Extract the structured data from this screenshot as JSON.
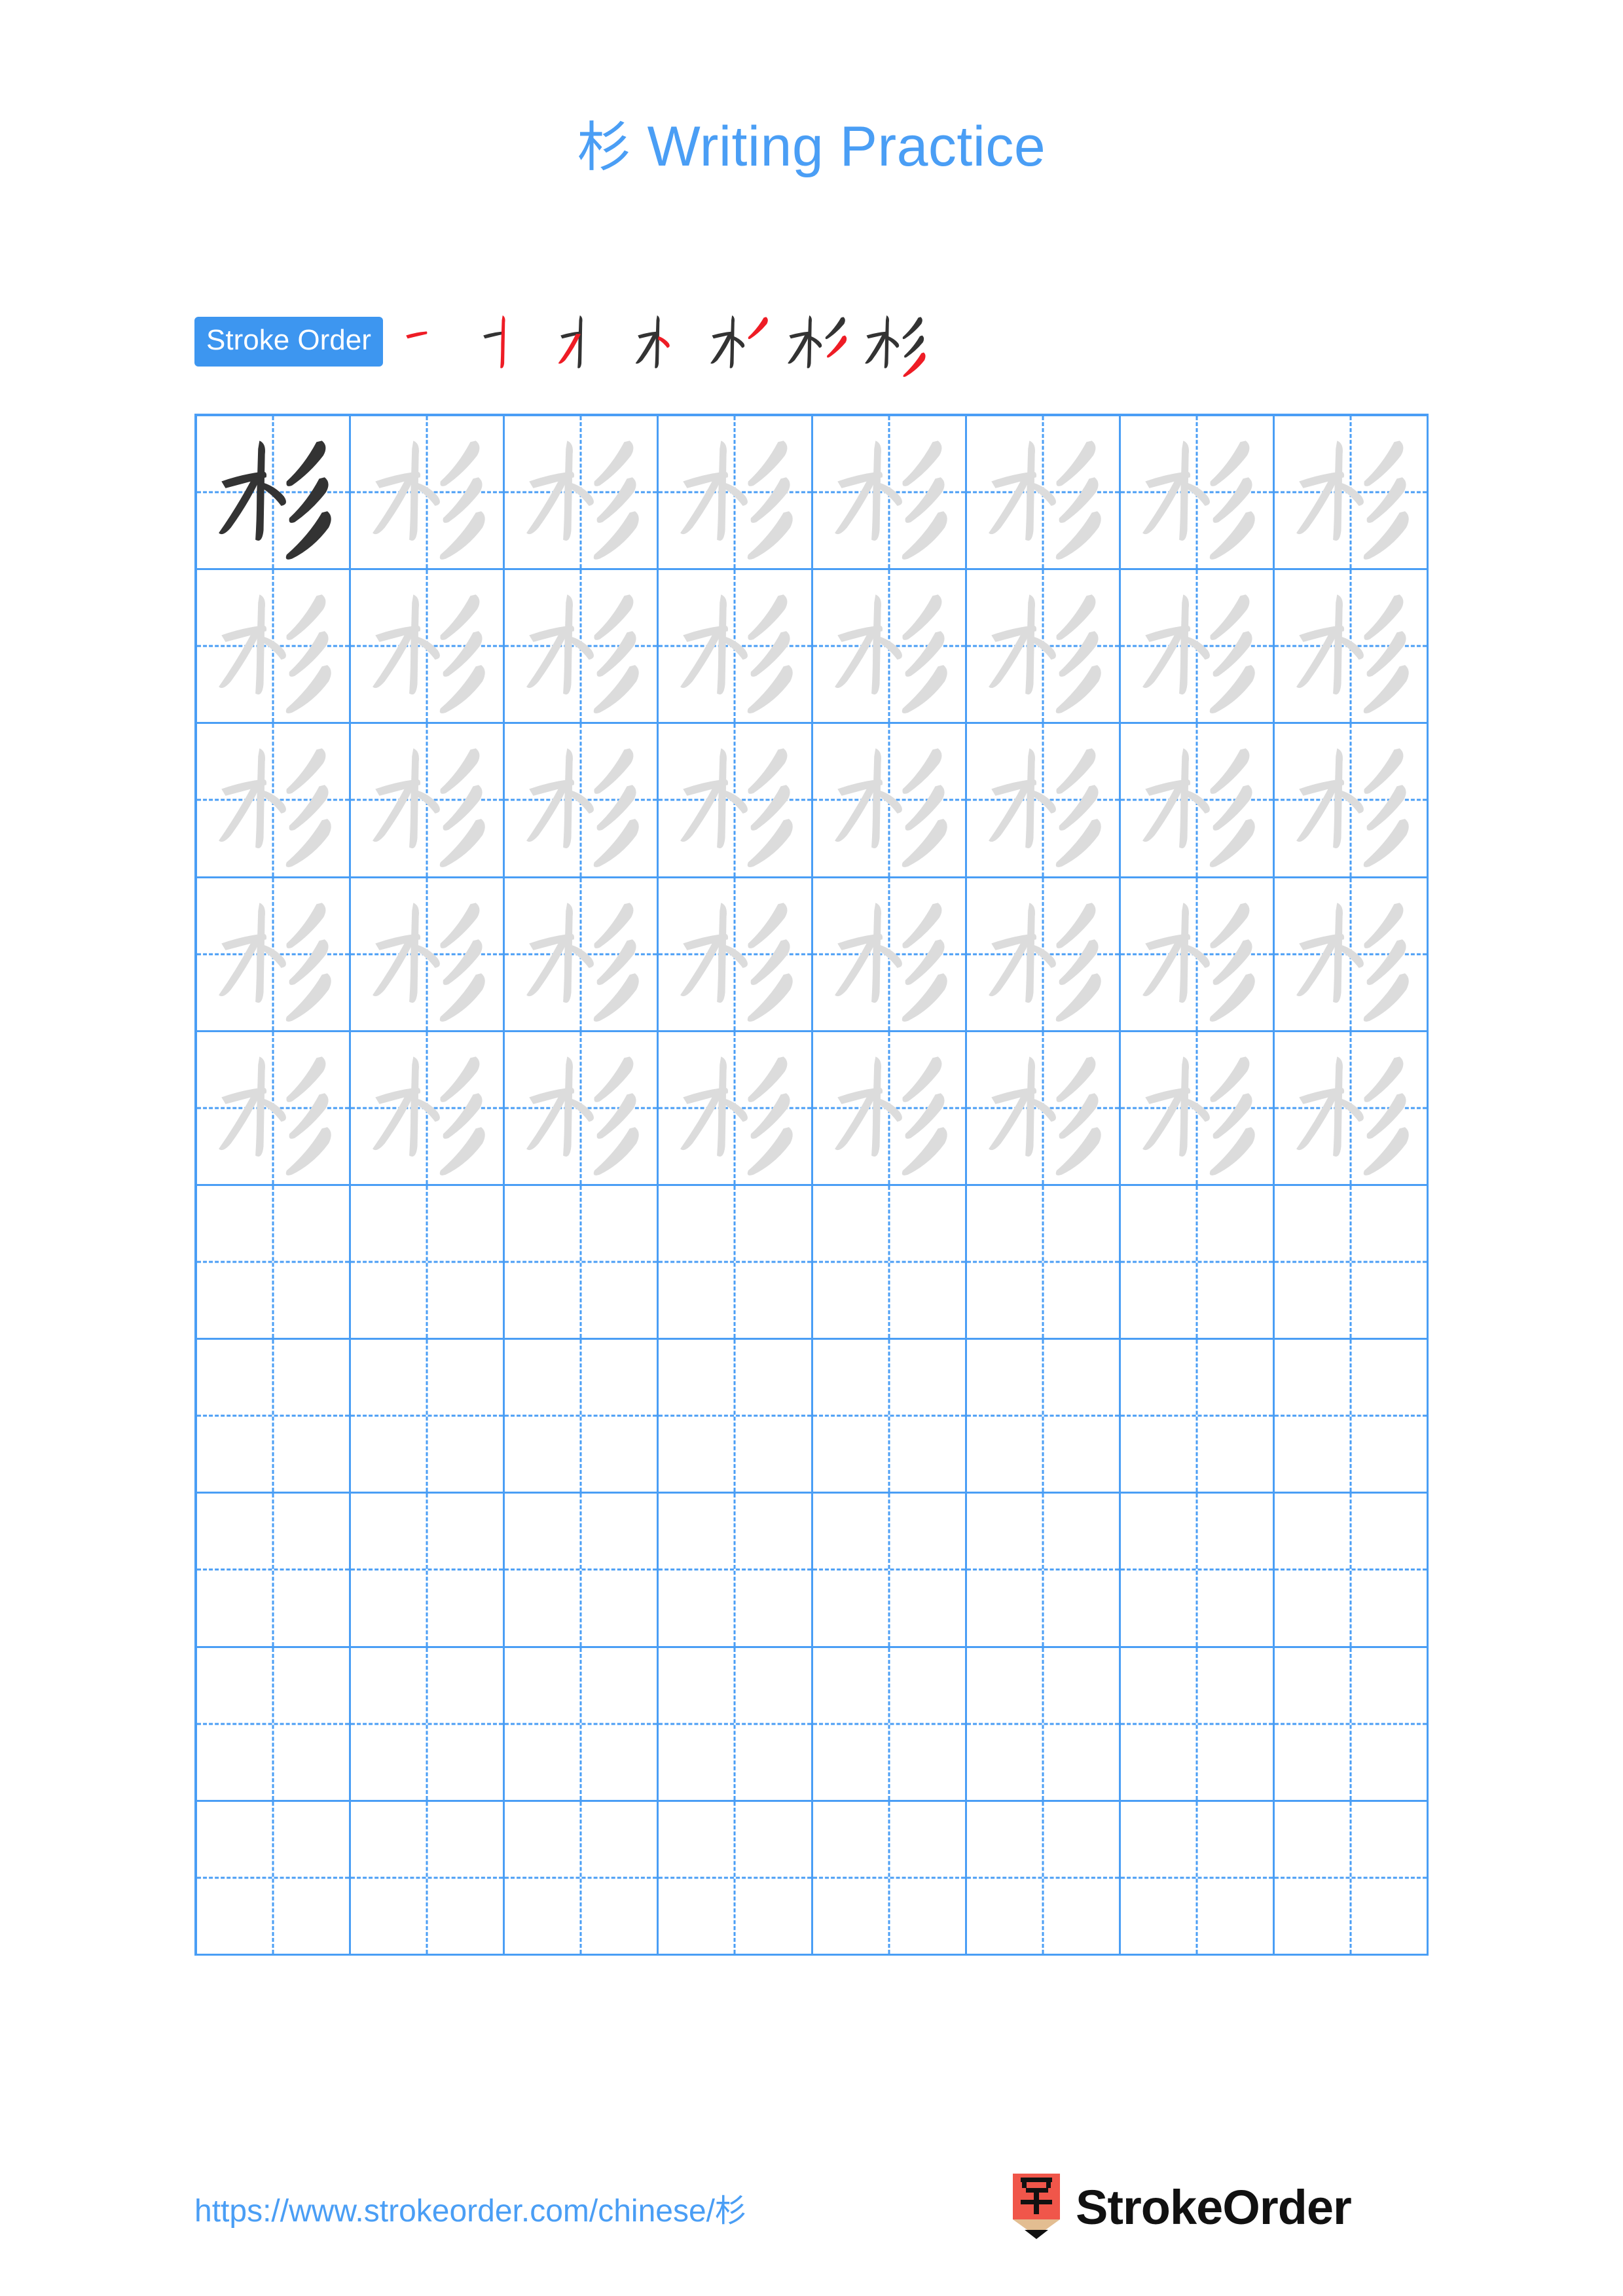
{
  "page": {
    "title_character": "杉",
    "title_text": "Writing Practice",
    "background_color": "#ffffff",
    "accent_blue": "#4a9ef5",
    "badge_blue": "#3d96f0",
    "stroke_highlight_red": "#ee1c25",
    "ink_dark": "#333333",
    "ink_trace_gray": "#dcdcdc"
  },
  "stroke_order": {
    "label": "Stroke Order",
    "character": "杉",
    "total_strokes": 7,
    "steps": [
      {
        "index": 1,
        "name": "heng",
        "description": "horizontal"
      },
      {
        "index": 2,
        "name": "shu",
        "description": "vertical"
      },
      {
        "index": 3,
        "name": "pie",
        "description": "left-falling"
      },
      {
        "index": 4,
        "name": "dian",
        "description": "right dot"
      },
      {
        "index": 5,
        "name": "pie-1",
        "description": "first slanted stroke of 彡"
      },
      {
        "index": 6,
        "name": "pie-2",
        "description": "second slanted stroke of 彡"
      },
      {
        "index": 7,
        "name": "pie-3",
        "description": "third slanted stroke of 彡"
      }
    ]
  },
  "practice_grid": {
    "columns": 8,
    "rows": 10,
    "character": "杉",
    "filled_rows": 5,
    "empty_rows": 5,
    "cell_states": [
      [
        "dark",
        "trace",
        "trace",
        "trace",
        "trace",
        "trace",
        "trace",
        "trace"
      ],
      [
        "trace",
        "trace",
        "trace",
        "trace",
        "trace",
        "trace",
        "trace",
        "trace"
      ],
      [
        "trace",
        "trace",
        "trace",
        "trace",
        "trace",
        "trace",
        "trace",
        "trace"
      ],
      [
        "trace",
        "trace",
        "trace",
        "trace",
        "trace",
        "trace",
        "trace",
        "trace"
      ],
      [
        "trace",
        "trace",
        "trace",
        "trace",
        "trace",
        "trace",
        "trace",
        "trace"
      ],
      [
        "empty",
        "empty",
        "empty",
        "empty",
        "empty",
        "empty",
        "empty",
        "empty"
      ],
      [
        "empty",
        "empty",
        "empty",
        "empty",
        "empty",
        "empty",
        "empty",
        "empty"
      ],
      [
        "empty",
        "empty",
        "empty",
        "empty",
        "empty",
        "empty",
        "empty",
        "empty"
      ],
      [
        "empty",
        "empty",
        "empty",
        "empty",
        "empty",
        "empty",
        "empty",
        "empty"
      ],
      [
        "empty",
        "empty",
        "empty",
        "empty",
        "empty",
        "empty",
        "empty",
        "empty"
      ]
    ]
  },
  "footer": {
    "url": "https://www.strokeorder.com/chinese/杉",
    "logo_character": "字",
    "brand_name": "StrokeOrder",
    "logo_body_color": "#f0564a",
    "logo_tip_color": "#e3bd91"
  }
}
